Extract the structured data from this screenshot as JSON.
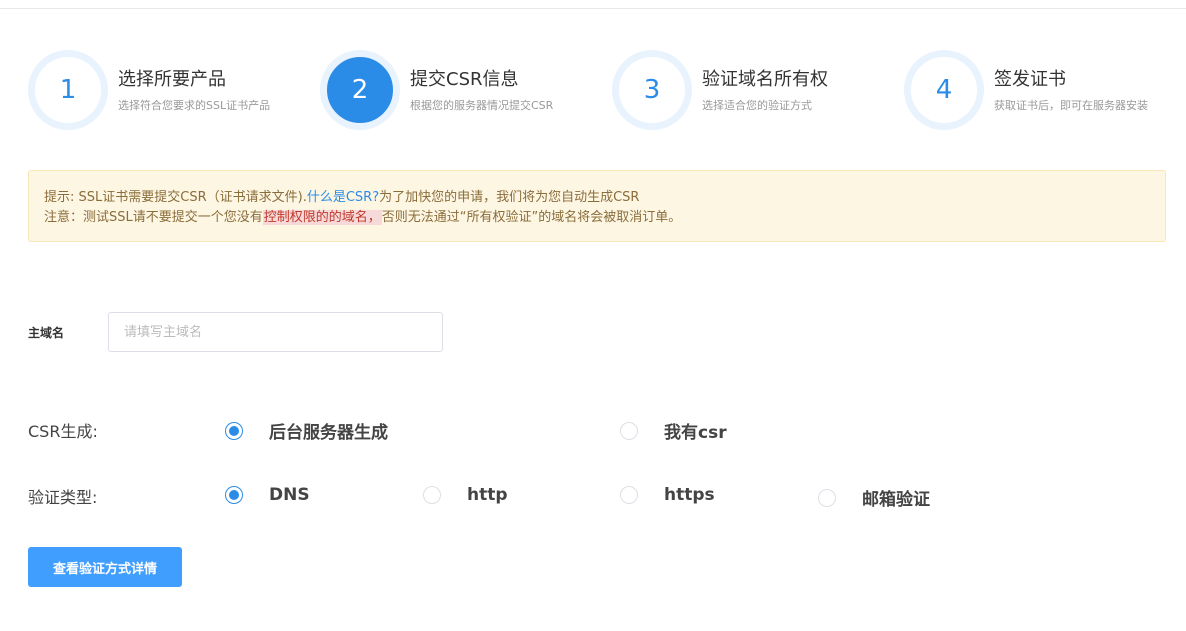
{
  "steps": [
    {
      "number": "1",
      "title": "选择所要产品",
      "desc": "选择符合您要求的SSL证书产品",
      "active": false
    },
    {
      "number": "2",
      "title": "提交CSR信息",
      "desc": "根据您的服务器情况提交CSR",
      "active": true
    },
    {
      "number": "3",
      "title": "验证域名所有权",
      "desc": "选择适合您的验证方式",
      "active": false
    },
    {
      "number": "4",
      "title": "签发证书",
      "desc": "获取证书后，即可在服务器安装",
      "active": false
    }
  ],
  "notice": {
    "line1_prefix": "提示: SSL证书需要提交CSR（证书请求文件).",
    "line1_link": "什么是CSR?",
    "line1_suffix": "为了加快您的申请，我们将为您自动生成CSR",
    "line2_prefix": "注意：测试SSL请不要提交一个您没有",
    "line2_highlight": "控制权限的的域名，",
    "line2_suffix": "否则无法通过“所有权验证”的域名将会被取消订单。"
  },
  "domain": {
    "label": "主域名",
    "placeholder": "请填写主域名",
    "value": ""
  },
  "csr": {
    "label": "CSR生成:",
    "options": [
      {
        "label": "后台服务器生成",
        "checked": true
      },
      {
        "label": "我有csr",
        "checked": false
      }
    ]
  },
  "verify": {
    "label": "验证类型:",
    "options": [
      {
        "label": "DNS",
        "checked": true
      },
      {
        "label": "http",
        "checked": false
      },
      {
        "label": "https",
        "checked": false
      },
      {
        "label": "邮箱验证",
        "checked": false
      }
    ]
  },
  "button": {
    "label": "查看验证方式详情"
  },
  "colors": {
    "accent": "#2b8ce8",
    "button": "#409eff",
    "notice_bg": "#fdf6e3"
  }
}
